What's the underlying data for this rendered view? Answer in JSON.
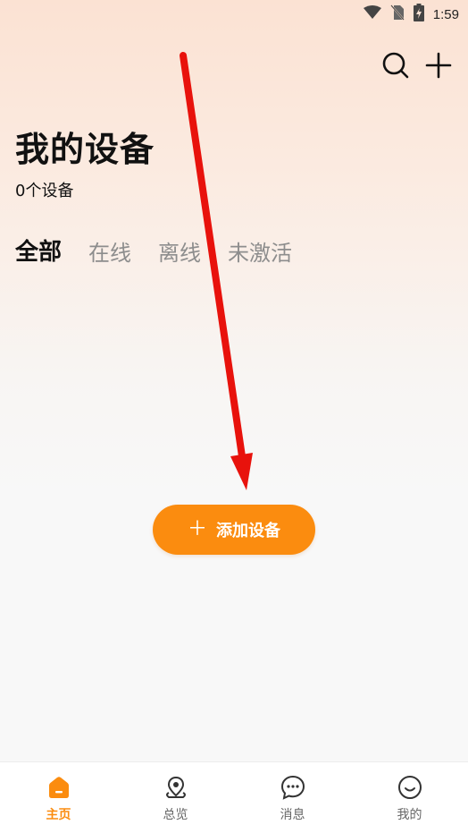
{
  "status_bar": {
    "time": "1:59",
    "icons": [
      "wifi-icon",
      "no-sim-icon",
      "battery-charging-icon"
    ]
  },
  "header": {
    "title": "我的设备",
    "device_count": "0个设备",
    "actions": [
      {
        "name": "search-icon",
        "label": ""
      },
      {
        "name": "plus-icon",
        "label": ""
      }
    ]
  },
  "tabs": [
    {
      "label": "全部",
      "active": true
    },
    {
      "label": "在线",
      "active": false
    },
    {
      "label": "离线",
      "active": false
    },
    {
      "label": "未激活",
      "active": false
    }
  ],
  "main": {
    "add_device_label": "添加设备",
    "add_device_icon": "plus-icon"
  },
  "bottom_nav": [
    {
      "label": "主页",
      "icon": "home-icon",
      "active": true
    },
    {
      "label": "总览",
      "icon": "location-pin-icon",
      "active": false
    },
    {
      "label": "消息",
      "icon": "chat-bubble-icon",
      "active": false
    },
    {
      "label": "我的",
      "icon": "smiley-face-icon",
      "active": false
    }
  ],
  "colors": {
    "accent": "#fb8c0f",
    "annotation": "#e8120c",
    "tab_inactive": "#8d8d8d",
    "nav_inactive": "#666666"
  }
}
